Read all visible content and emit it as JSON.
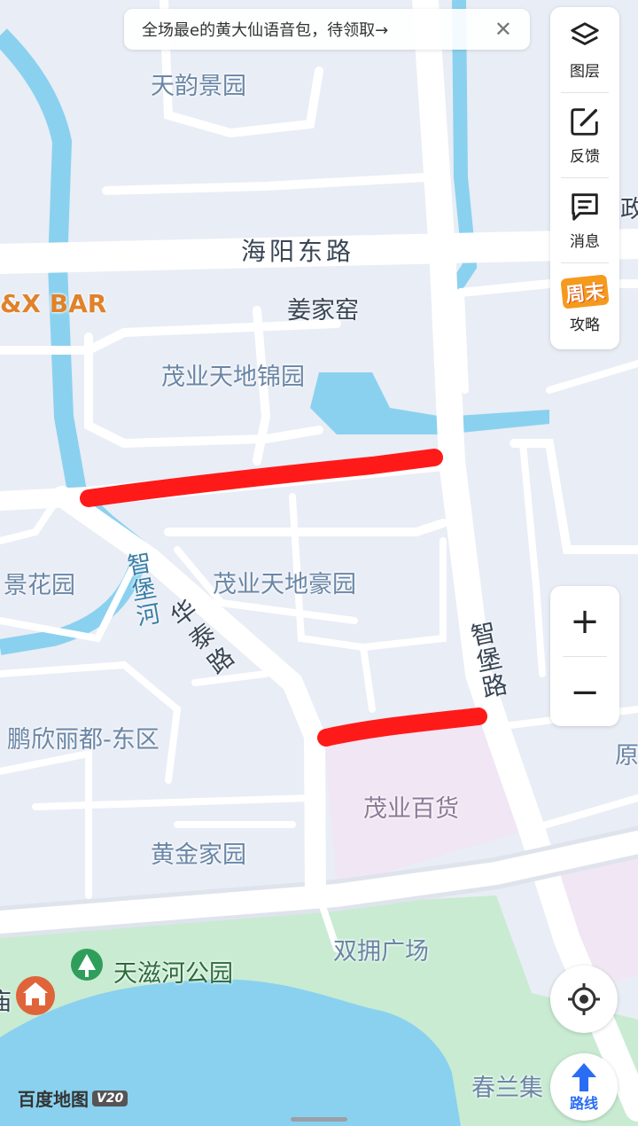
{
  "banner": {
    "text": "全场最e的黄大仙语音包，待领取→",
    "close": "✕"
  },
  "toolbar": {
    "layers": "图层",
    "feedback": "反馈",
    "messages": "消息",
    "weekend_badge": "周末",
    "guide": "攻略"
  },
  "zoom": {
    "in": "+",
    "out": "−"
  },
  "route_label": "路线",
  "watermark": {
    "text": "百度地图",
    "version": "V20"
  },
  "labels": {
    "tianyun": "天韵景园",
    "haiyang": "海阳东路",
    "bar": "&X BAR",
    "jiangjiayao": "姜家窑",
    "jinyuan": "茂业天地锦园",
    "jinghua": "景花园",
    "haoyuan": "茂业天地豪园",
    "zhibaohe": "智堡河",
    "huatai": "华泰路",
    "zhibaolu": "智堡路",
    "pengxin": "鹏欣丽都-东区",
    "baihuo": "茂业百货",
    "huangjin": "黄金家园",
    "shuangyong": "双拥广场",
    "tianzi": "天滋河公园",
    "chunlan": "春兰集",
    "right_edge_1": "政",
    "right_edge_2": "原",
    "left_edge": "庙"
  },
  "colors": {
    "road": "#ffffff",
    "water": "#8ad1ef",
    "park": "#c8ebd2",
    "block": "#e9edf5",
    "commercial": "#f1e6f3",
    "highlight": "#ff1a1a",
    "accent": "#2a6df5"
  }
}
